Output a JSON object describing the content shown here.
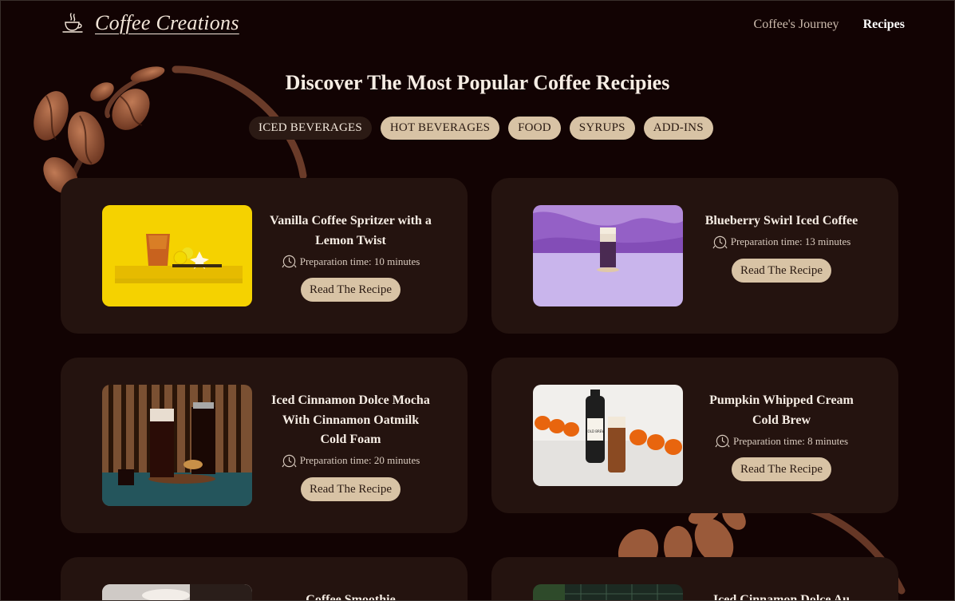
{
  "brand": {
    "name": "Coffee Creations",
    "icon": "coffee-cup-icon"
  },
  "nav": [
    {
      "label": "Coffee's Journey",
      "active": false
    },
    {
      "label": "Recipes",
      "active": true
    }
  ],
  "page_title": "Discover The Most Popular Coffee Recipies",
  "categories": [
    {
      "label": "ICED BEVERAGES",
      "active": true
    },
    {
      "label": "HOT BEVERAGES",
      "active": false
    },
    {
      "label": "FOOD",
      "active": false
    },
    {
      "label": "SYRUPS",
      "active": false
    },
    {
      "label": "ADD-INS",
      "active": false
    }
  ],
  "recipes": [
    {
      "name": "Vanilla Coffee Spritzer with a Lemon Twist",
      "prep": "Preparation time: 10 minutes",
      "button": "Read The Recipe"
    },
    {
      "name": "Blueberry Swirl Iced Coffee",
      "prep": "Preparation time: 13 minutes",
      "button": "Read The Recipe"
    },
    {
      "name": "Iced Cinnamon Dolce Mocha With Cinnamon Oatmilk Cold Foam",
      "prep": "Preparation time: 20 minutes",
      "button": "Read The Recipe"
    },
    {
      "name": "Pumpkin Whipped Cream Cold Brew",
      "prep": "Preparation time: 8 minutes",
      "button": "Read The Recipe"
    },
    {
      "name": "Coffee Smoothie",
      "prep": "",
      "button": ""
    },
    {
      "name": "Iced Cinnamon Dolce Au",
      "prep": "",
      "button": ""
    }
  ],
  "photo_labels": {
    "cold_brew_bottle": "COLD BREW"
  },
  "colors": {
    "background": "#120303",
    "card": "#24130f",
    "pill": "#d8c3a5",
    "pill_active": "#2b1a14",
    "accent_text": "#f6ede4"
  }
}
